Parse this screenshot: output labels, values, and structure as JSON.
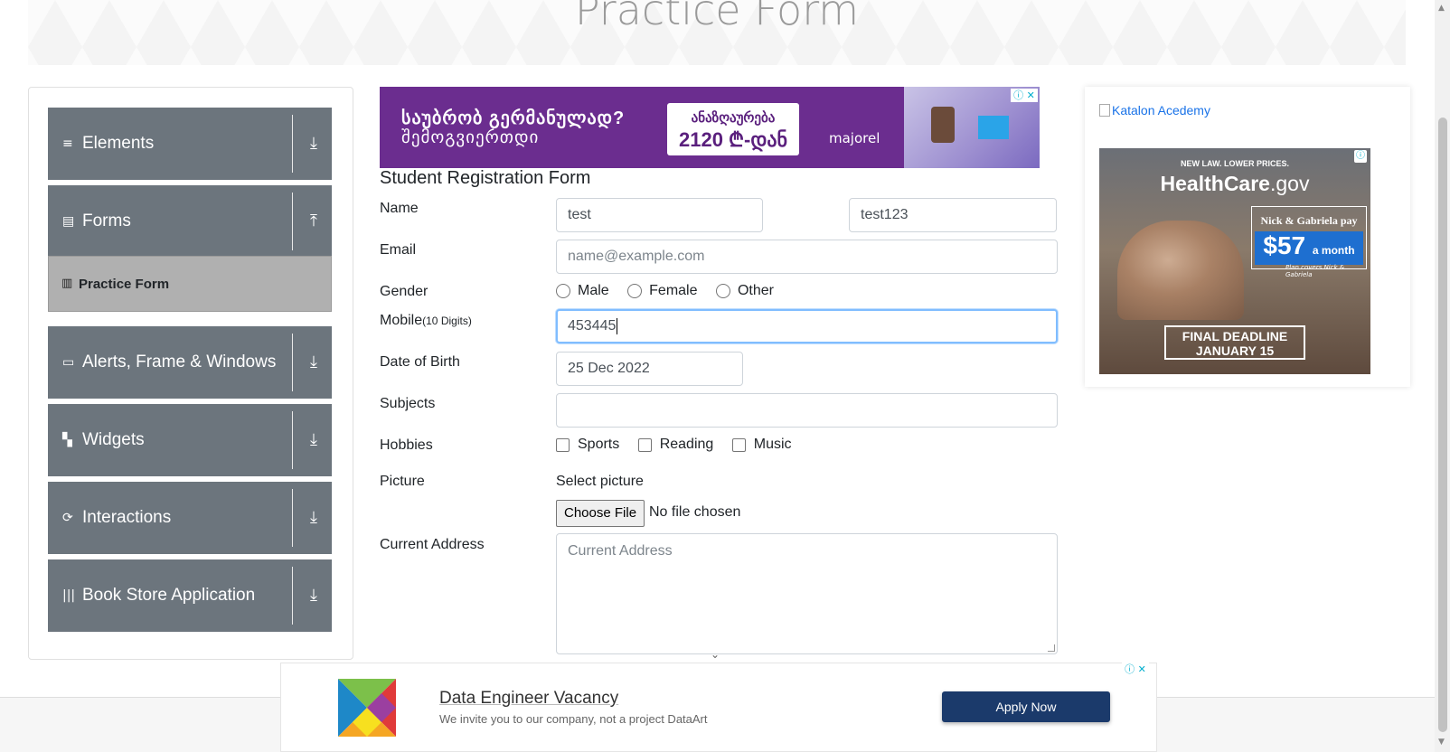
{
  "header": {
    "title": "Practice Form"
  },
  "sidebar": {
    "groups": [
      {
        "label": "Elements",
        "icon": "hamburger-icon",
        "arrow": "⤓"
      },
      {
        "label": "Forms",
        "icon": "document-icon",
        "arrow": "⤒"
      },
      {
        "label": "Alerts, Frame & Windows",
        "icon": "window-icon",
        "arrow": "⤓"
      },
      {
        "label": "Widgets",
        "icon": "widgets-icon",
        "arrow": "⤓"
      },
      {
        "label": "Interactions",
        "icon": "interactions-icon",
        "arrow": "⤓"
      },
      {
        "label": "Book Store Application",
        "icon": "bookshelf-icon",
        "arrow": "⤓"
      }
    ],
    "active_item": {
      "label": "Practice Form",
      "icon": "form-icon"
    }
  },
  "top_ad": {
    "line1": "საუბრობ გერმანულად?",
    "line2": "შემოგვიერთდი",
    "box_line1": "ანაზღაურება",
    "box_line2": "2120 ₾-დან",
    "brand": "majorel"
  },
  "form": {
    "title": "Student Registration Form",
    "name_label": "Name",
    "first_name_value": "test",
    "last_name_value": "test123",
    "email_label": "Email",
    "email_placeholder": "name@example.com",
    "gender_label": "Gender",
    "gender_options": [
      "Male",
      "Female",
      "Other"
    ],
    "mobile_label": "Mobile",
    "mobile_hint": "(10 Digits)",
    "mobile_value": "453445",
    "dob_label": "Date of Birth",
    "dob_value": "25 Dec 2022",
    "subjects_label": "Subjects",
    "hobbies_label": "Hobbies",
    "hobbies_options": [
      "Sports",
      "Reading",
      "Music"
    ],
    "picture_label": "Picture",
    "select_picture": "Select picture",
    "choose_file": "Choose File",
    "file_status": "No file chosen",
    "address_label": "Current Address",
    "address_placeholder": "Current Address"
  },
  "right_ad": {
    "link_text": "Katalon Acedemy",
    "top_line": "NEW LAW. LOWER PRICES.",
    "logo_main": "HealthCare",
    "logo_suffix": ".gov",
    "price_line1": "Nick & Gabriela pay",
    "price_value": "$57",
    "price_unit": "a month",
    "covers": "Plan covers Nick & Gabriela",
    "deadline_line1": "FINAL DEADLINE",
    "deadline_line2": "JANUARY 15"
  },
  "bottom_ad": {
    "headline": "Data Engineer Vacancy",
    "sub": "We invite you to our company, not a project DataArt",
    "button": "Apply Now"
  },
  "ad_controls": {
    "info": "ⓘ",
    "close": "✕"
  }
}
